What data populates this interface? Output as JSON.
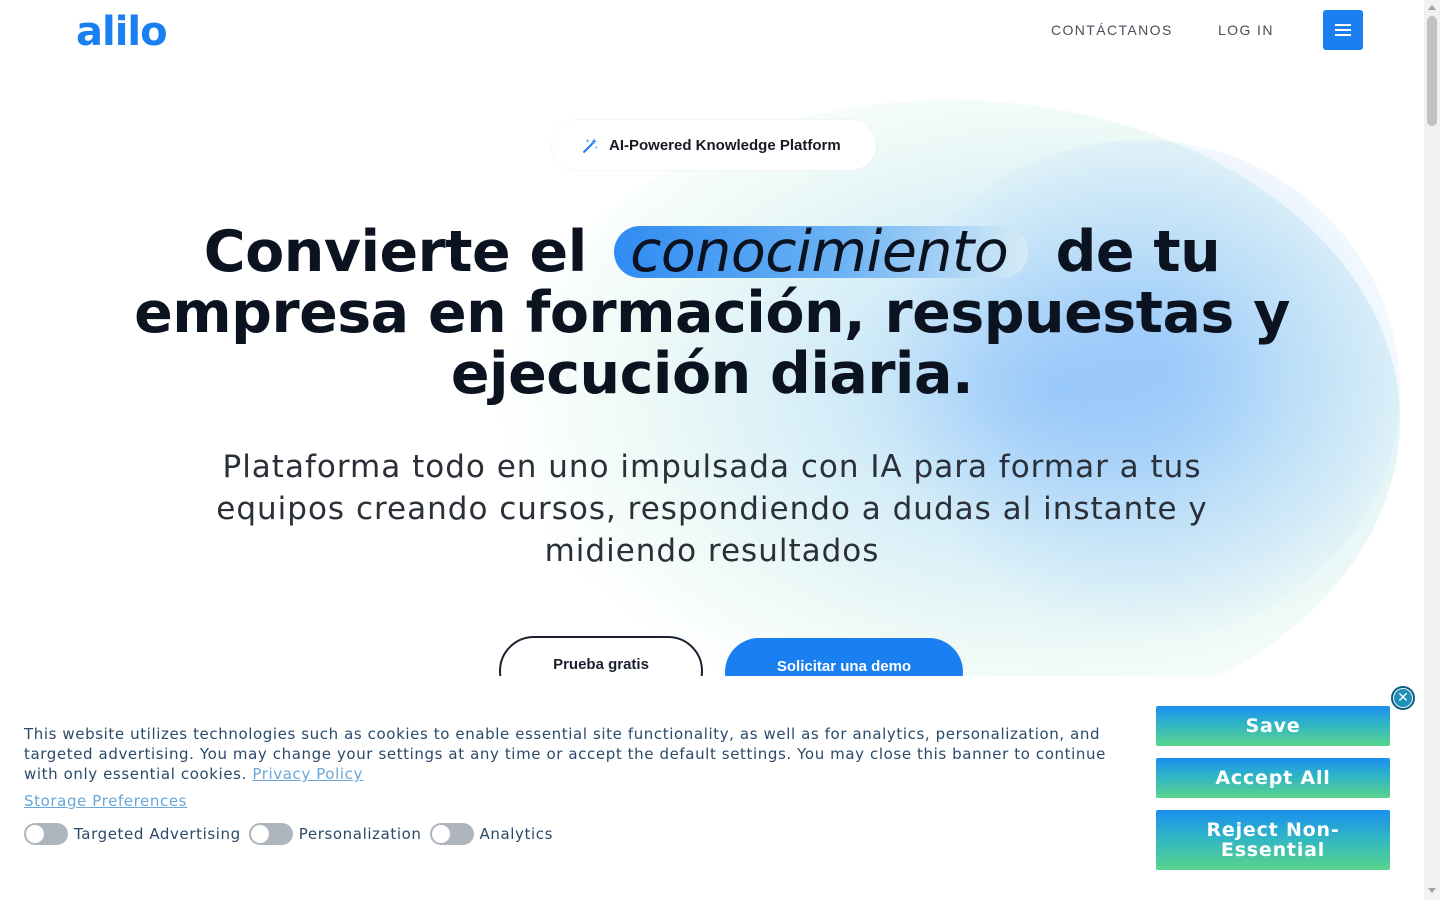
{
  "header": {
    "logo": "alilo",
    "nav": {
      "contact": "CONTÁCTANOS",
      "login": "LOG IN"
    },
    "menu_icon": "hamburger-menu-icon"
  },
  "hero": {
    "badge": {
      "icon": "magic-wand-icon",
      "text": "AI-Powered Knowledge Platform"
    },
    "headline": {
      "before": "Convierte el",
      "highlight": "conocimiento",
      "after": "de tu empresa en formación, respuestas y ejecución diaria."
    },
    "subtitle": "Plataforma todo en uno impulsada con IA para formar a tus equipos creando cursos, respondiendo a dudas al instante y midiendo resultados",
    "cta": {
      "secondary": "Prueba gratis",
      "primary": "Solicitar una demo"
    }
  },
  "cookie_banner": {
    "text": "This website utilizes technologies such as cookies to enable essential site functionality, as well as for analytics, personalization, and targeted advertising. You may change your settings at any time or accept the default settings. You may close this banner to continue with only essential cookies.",
    "privacy_link": "Privacy Policy",
    "storage_link": "Storage Preferences",
    "toggles": [
      {
        "label": "Targeted Advertising",
        "enabled": false
      },
      {
        "label": "Personalization",
        "enabled": false
      },
      {
        "label": "Analytics",
        "enabled": false
      }
    ],
    "buttons": {
      "save": "Save",
      "accept": "Accept All",
      "reject": "Reject Non-Essential"
    },
    "close_icon": "close-icon"
  },
  "colors": {
    "brand": "#1a7ff0",
    "text_dark": "#0b1220",
    "cookie_text": "#2a4a6b",
    "link": "#6aa7d8"
  }
}
